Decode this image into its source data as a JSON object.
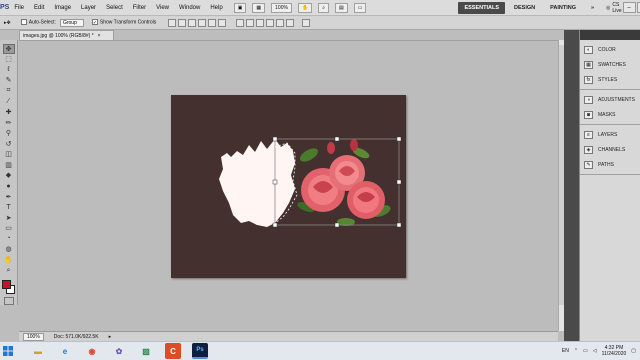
{
  "menubar": {
    "logo": "PS",
    "items": [
      "File",
      "Edit",
      "Image",
      "Layer",
      "Select",
      "Filter",
      "View",
      "Window",
      "Help"
    ],
    "zoom": "100%",
    "workspaces": [
      "ESSENTIALS",
      "DESIGN",
      "PAINTING"
    ],
    "more": "»",
    "cs_live": "CS Live"
  },
  "options": {
    "auto_select_label": "Auto-Select:",
    "auto_select_value": "Group",
    "show_transform_label": "Show Transform Controls"
  },
  "document": {
    "tab_title": "images.jpg @ 100% (RGB/8#) *",
    "close": "×"
  },
  "status": {
    "zoom": "100%",
    "doc_info": "Doc: 571.0K/922.5K"
  },
  "panels": {
    "group1": [
      "COLOR",
      "SWATCHES",
      "STYLES"
    ],
    "group2": [
      "ADJUSTMENTS",
      "MASKS"
    ],
    "group3": [
      "LAYERS",
      "CHANNELS",
      "PATHS"
    ]
  },
  "taskbar": {
    "lang": "EN",
    "time": "4:32 PM",
    "date": "11/24/2020"
  },
  "colors": {
    "foreground": "#c8102e",
    "background": "#ffffff",
    "canvas": "#44302f"
  }
}
